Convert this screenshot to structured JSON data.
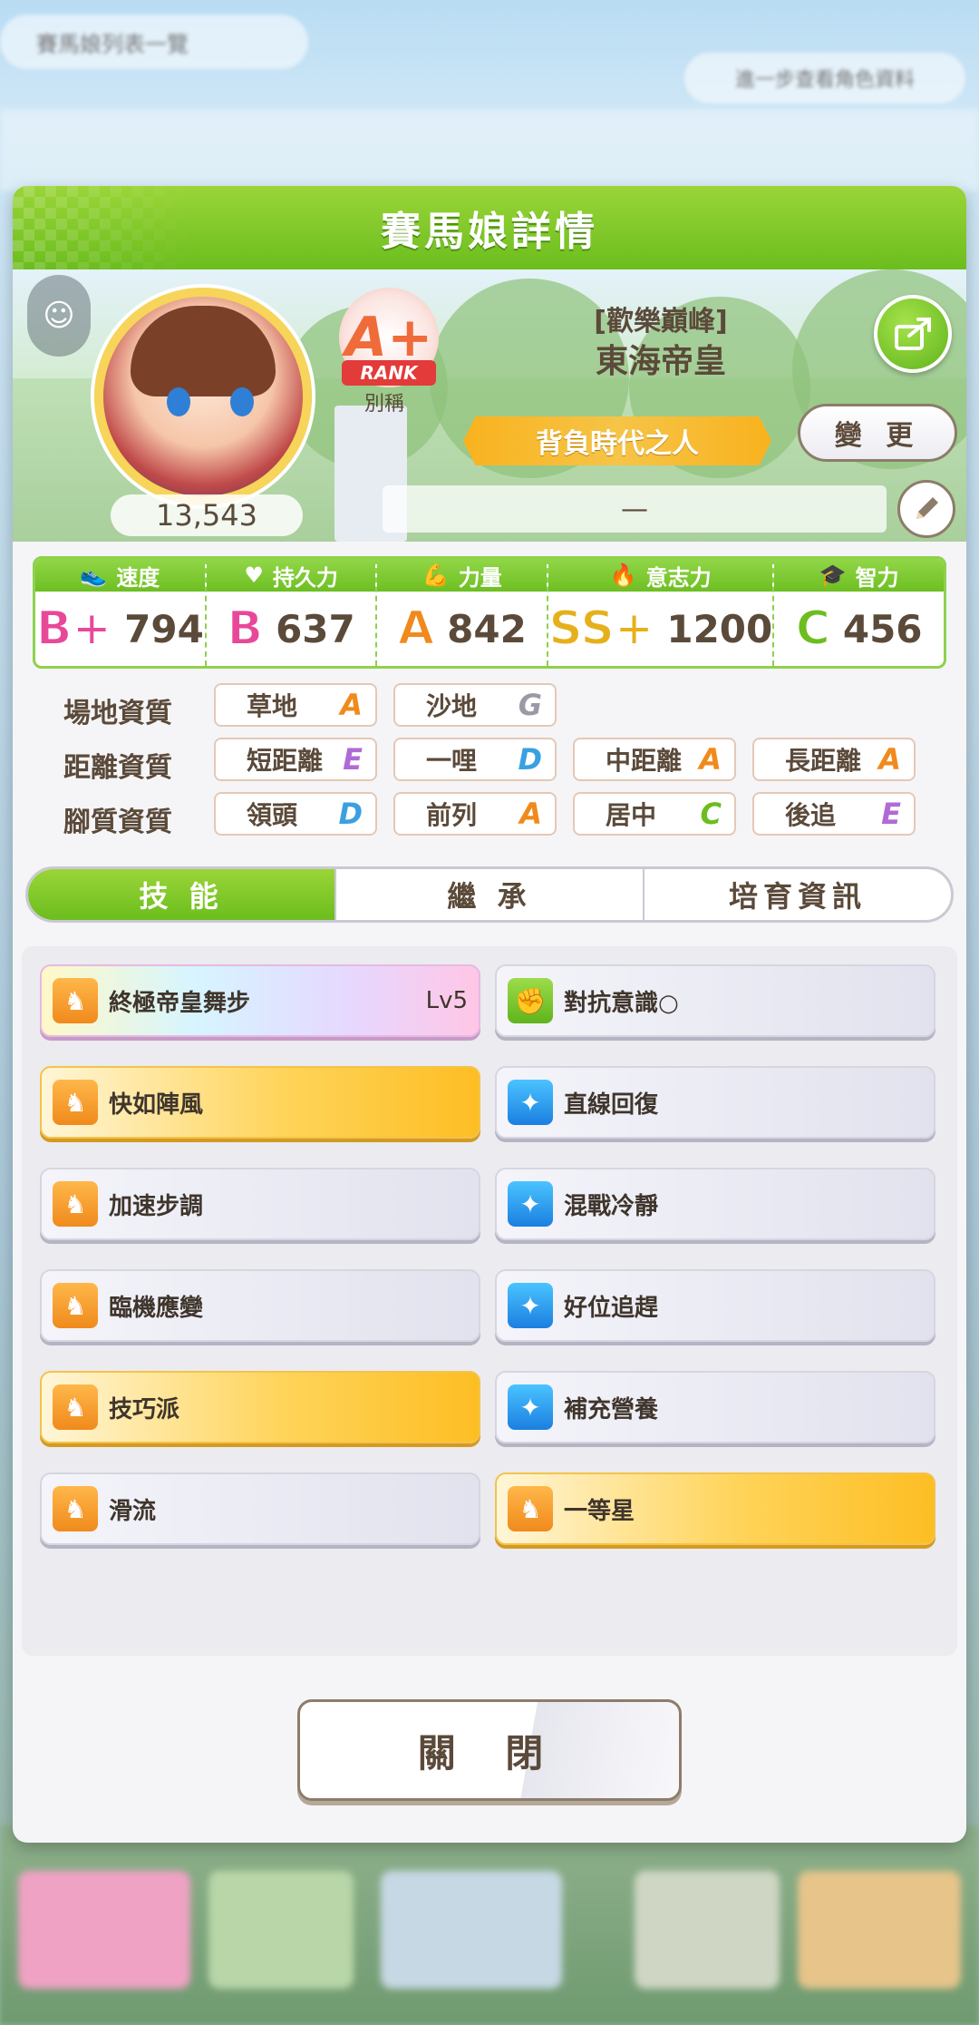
{
  "background": {
    "top_left_banner": "賽馬娘列表一覽",
    "top_right_banner": "進一步查看角色資料"
  },
  "header": {
    "title": "賽馬娘詳情"
  },
  "profile": {
    "fans": "13,543",
    "rank": "A+",
    "rank_tag": "RANK",
    "nickname_label": "別稱",
    "title_bracket": "[歡樂巔峰]",
    "character_name": "東海帝皇",
    "epithet": "背負時代之人",
    "change_label": "變 更",
    "comment": "—"
  },
  "stats": [
    {
      "label": "速度",
      "icon": "shoe-icon",
      "grade": "B+",
      "value": "794",
      "color": "#e8489a"
    },
    {
      "label": "持久力",
      "icon": "heart-icon",
      "grade": "B",
      "value": "637",
      "color": "#e8489a"
    },
    {
      "label": "力量",
      "icon": "muscle-icon",
      "grade": "A",
      "value": "842",
      "color": "#f08a1c"
    },
    {
      "label": "意志力",
      "icon": "flame-icon",
      "grade": "SS+",
      "value": "1200",
      "color": "#e6b01c"
    },
    {
      "label": "智力",
      "icon": "graduation-cap-icon",
      "grade": "C",
      "value": "456",
      "color": "#6cbd1e"
    }
  ],
  "aptitudes": {
    "track": {
      "label": "場地資質",
      "items": [
        {
          "name": "草地",
          "grade": "A",
          "color": "#f08a1c"
        },
        {
          "name": "沙地",
          "grade": "G",
          "color": "#9a9aa6"
        }
      ]
    },
    "distance": {
      "label": "距離資質",
      "items": [
        {
          "name": "短距離",
          "grade": "E",
          "color": "#b06ad6"
        },
        {
          "name": "一哩",
          "grade": "D",
          "color": "#3aa0e0"
        },
        {
          "name": "中距離",
          "grade": "A",
          "color": "#f08a1c"
        },
        {
          "name": "長距離",
          "grade": "A",
          "color": "#f08a1c"
        }
      ]
    },
    "style": {
      "label": "腳質資質",
      "items": [
        {
          "name": "領頭",
          "grade": "D",
          "color": "#3aa0e0"
        },
        {
          "name": "前列",
          "grade": "A",
          "color": "#f08a1c"
        },
        {
          "name": "居中",
          "grade": "C",
          "color": "#6cbd1e"
        },
        {
          "name": "後追",
          "grade": "E",
          "color": "#b06ad6"
        }
      ]
    }
  },
  "tabs": [
    "技 能",
    "繼 承",
    "培育資訊"
  ],
  "skills": [
    {
      "name": "終極帝皇舞步",
      "level": "Lv5",
      "style": "rainbow",
      "icon": "ic-orange"
    },
    {
      "name": "對抗意識○",
      "level": "",
      "style": "normal",
      "icon": "ic-green"
    },
    {
      "name": "快如陣風",
      "level": "",
      "style": "gold",
      "icon": "ic-orange"
    },
    {
      "name": "直線回復",
      "level": "",
      "style": "normal",
      "icon": "ic-blue"
    },
    {
      "name": "加速步調",
      "level": "",
      "style": "normal",
      "icon": "ic-orange"
    },
    {
      "name": "混戰冷靜",
      "level": "",
      "style": "normal",
      "icon": "ic-blue"
    },
    {
      "name": "臨機應變",
      "level": "",
      "style": "normal",
      "icon": "ic-orange"
    },
    {
      "name": "好位追趕",
      "level": "",
      "style": "normal",
      "icon": "ic-blue"
    },
    {
      "name": "技巧派",
      "level": "",
      "style": "gold",
      "icon": "ic-orange"
    },
    {
      "name": "補充營養",
      "level": "",
      "style": "normal",
      "icon": "ic-blue"
    },
    {
      "name": "滑流",
      "level": "",
      "style": "normal",
      "icon": "ic-orange"
    },
    {
      "name": "一等星",
      "level": "",
      "style": "gold",
      "icon": "ic-orange"
    }
  ],
  "close_label": "關 閉"
}
